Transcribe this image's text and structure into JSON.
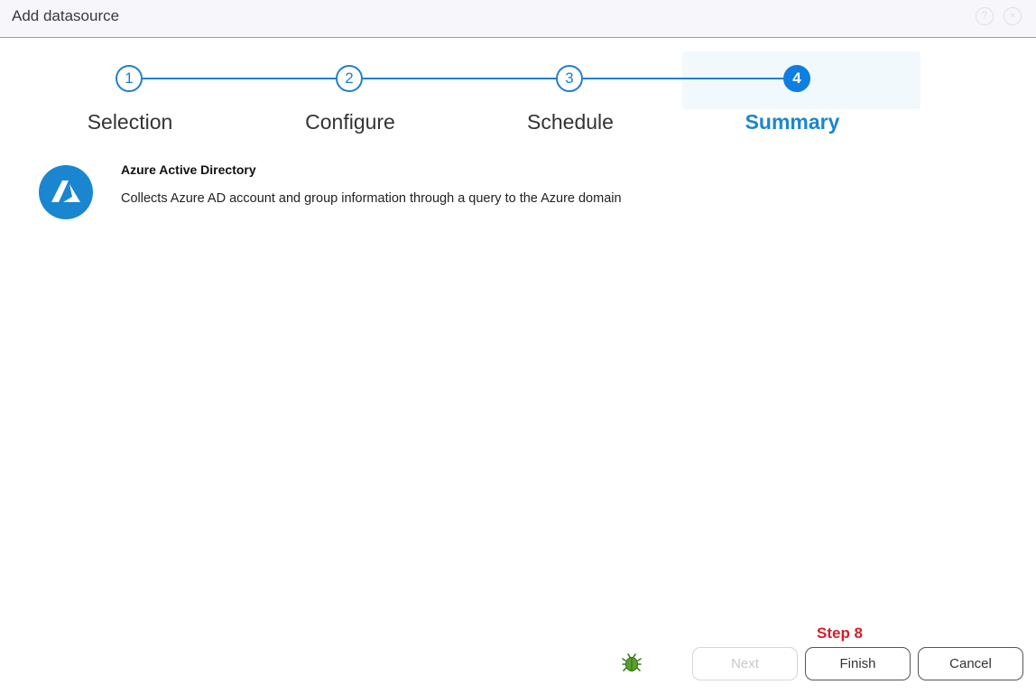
{
  "window": {
    "title": "Add datasource",
    "help_icon": "?",
    "close_icon": "×"
  },
  "stepper": {
    "steps": [
      {
        "number": "1",
        "label": "Selection",
        "active": false
      },
      {
        "number": "2",
        "label": "Configure",
        "active": false
      },
      {
        "number": "3",
        "label": "Schedule",
        "active": false
      },
      {
        "number": "4",
        "label": "Summary",
        "active": true
      }
    ],
    "accent_color": "#1f7fd1"
  },
  "summary": {
    "datasource_name": "Azure Active Directory",
    "datasource_description": "Collects Azure AD account and group information through a query to the Azure domain",
    "logo_icon": "azure-logo-icon",
    "logo_color": "#1a86d0"
  },
  "annotation": {
    "text": "Step 8",
    "color": "#d3202b"
  },
  "footer": {
    "bug_icon": "bug-icon",
    "next_label": "Next",
    "finish_label": "Finish",
    "cancel_label": "Cancel"
  }
}
